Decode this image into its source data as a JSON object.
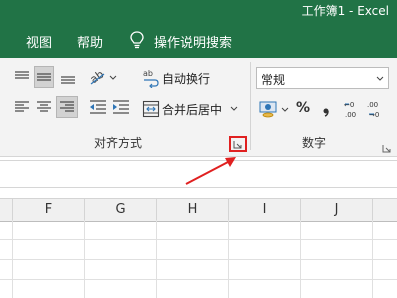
{
  "window": {
    "title": "工作簿1  -  Excel"
  },
  "menu": {
    "items": [
      "视图",
      "帮助"
    ],
    "tell_me": "操作说明搜索"
  },
  "ribbon": {
    "alignment": {
      "wrap_text": "自动换行",
      "merge_center": "合并后居中",
      "group_label": "对齐方式"
    },
    "number": {
      "format_value": "常规",
      "percent": "%",
      "group_label": "数字"
    }
  },
  "grid": {
    "columns": [
      "F",
      "G",
      "H",
      "I",
      "J"
    ]
  },
  "colors": {
    "excel_green": "#217346",
    "annotation_red": "#e02020"
  }
}
